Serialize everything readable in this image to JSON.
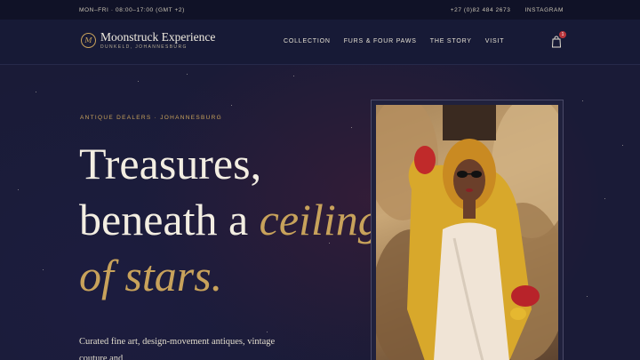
{
  "topbar": {
    "hours": "MON–FRI · 08:00–17:00 (GMT +2)",
    "phone": "+27 (0)82 484 2673",
    "instagram": "INSTAGRAM"
  },
  "header": {
    "logo_mark": "M",
    "brand_name": "Moonstruck Experience",
    "brand_location": "DUNKELD, JOHANNESBURG",
    "nav": [
      {
        "label": "COLLECTION"
      },
      {
        "label": "FURS & FOUR PAWS"
      },
      {
        "label": "THE STORY"
      },
      {
        "label": "VISIT"
      }
    ],
    "cart_count": "1"
  },
  "hero": {
    "eyebrow": "ANTIQUE DEALERS · JOHANNESBURG",
    "headline_line1": "Treasures,",
    "headline_line2a": "beneath a ",
    "headline_line2b": "ceiling",
    "headline_line3": "of stars.",
    "intro": "Curated fine art, design-movement antiques, vintage couture and"
  },
  "colors": {
    "background": "#151833",
    "accent_gold": "#c8a25b",
    "text_light": "#f3eee2",
    "badge_red": "#b8343a"
  }
}
